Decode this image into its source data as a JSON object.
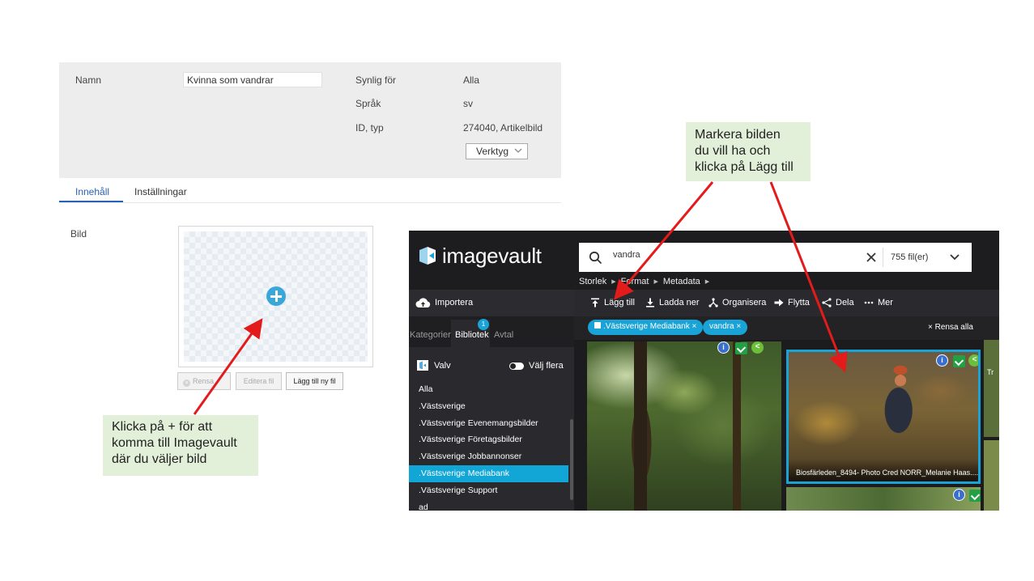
{
  "cms": {
    "name_label": "Namn",
    "name_value": "Kvinna som vandrar",
    "visible_label": "Synlig för",
    "visible_value": "Alla",
    "language_label": "Språk",
    "language_value": "sv",
    "id_label": "ID, typ",
    "id_value": "274040, Artikelbild",
    "tools_label": "Verktyg",
    "tabs": [
      {
        "label": "Innehåll"
      },
      {
        "label": "Inställningar"
      }
    ],
    "image_label": "Bild",
    "buttons": {
      "clear": "Rensa",
      "edit": "Editera fil",
      "add_new": "Lägg till ny fil"
    }
  },
  "callouts": {
    "left": [
      "Klicka på + för att",
      "komma till Imagevault",
      "där du väljer bild"
    ],
    "right": [
      "Markera bilden",
      "du vill ha och",
      "klicka på Lägg till"
    ]
  },
  "imagevault": {
    "logo_text": "imagevault",
    "search_value": "vandra",
    "file_count": "755 fil(er)",
    "filters": [
      "Storlek",
      "Format",
      "Metadata"
    ],
    "import_label": "Importera",
    "side_tabs": [
      {
        "label": "Kategorier"
      },
      {
        "label": "Bibliotek"
      },
      {
        "label": "Avtal"
      }
    ],
    "library_badge": "1",
    "vault_label": "Valv",
    "select_multiple_label": "Välj flera",
    "libraries": [
      "Alla",
      ".Västsverige",
      ".Västsverige Evenemangsbilder",
      ".Västsverige Företagsbilder",
      ".Västsverige Jobbannonser",
      ".Västsverige Mediabank",
      ".Västsverige Support",
      "ad"
    ],
    "actions": {
      "add": "Lägg till",
      "download": "Ladda ner",
      "organize": "Organisera",
      "move": "Flytta",
      "share": "Dela",
      "more": "Mer"
    },
    "chips": [
      ".Västsverige Mediabank",
      "vandra"
    ],
    "clear_all": "Rensa alla",
    "selected_caption": "Biosfärleden_8494- Photo Cred NORR_Melanie Haas....",
    "side_caption": "Tr"
  },
  "colors": {
    "accent": "#1aa3d6",
    "callout_bg": "#e2efd9",
    "arrow": "#e31b1b",
    "cms_tab_active": "#2a62b3"
  }
}
